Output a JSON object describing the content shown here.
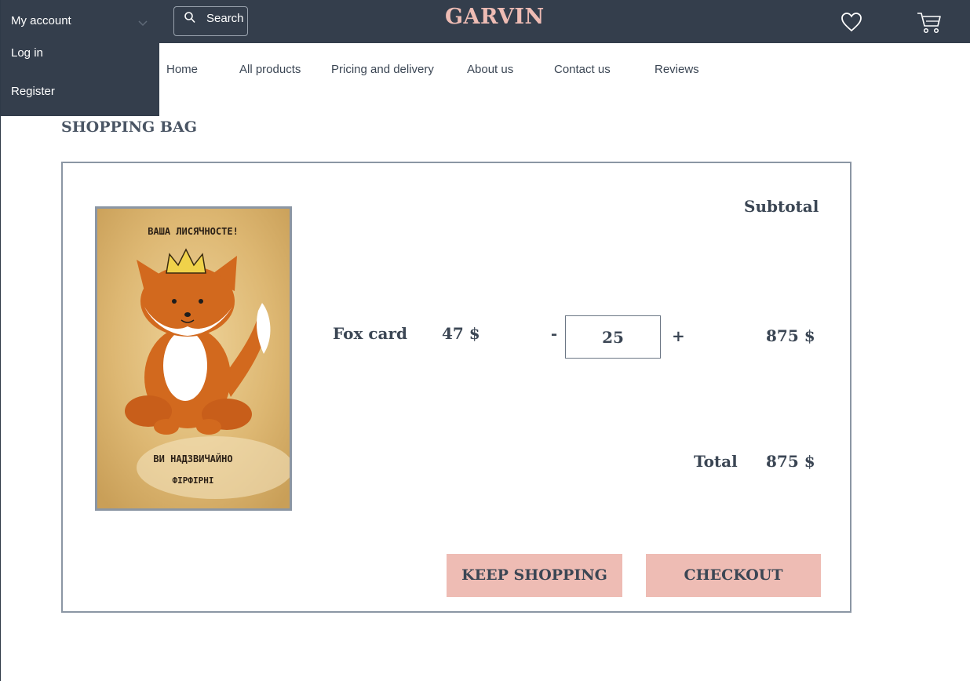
{
  "header": {
    "account_label": "My account",
    "account_menu": {
      "login_label": "Log in",
      "register_label": "Register"
    },
    "search_label": "Search",
    "logo_text": "GARVIN",
    "icons": {
      "search": "search-icon",
      "favorites": "heart-icon",
      "cart": "cart-icon",
      "dropdown": "chevron-down-icon"
    }
  },
  "nav": {
    "items": [
      "Home",
      "All products",
      "Pricing and delivery",
      "About us",
      "Contact us",
      "Reviews"
    ]
  },
  "page": {
    "title": "SHOPPING BAG"
  },
  "bag": {
    "subtotal_heading": "Subtotal",
    "item": {
      "name": "Fox card",
      "price": "47 $",
      "quantity": "25",
      "subtotal": "875 $",
      "image_text_top": "ВАША ЛИСЯЧНОСТЕ!",
      "image_text_bottom_1": "ВИ НАДЗВИЧАЙНО",
      "image_text_bottom_2": "ФІРФІРНІ"
    },
    "qty_minus": "-",
    "qty_plus": "+",
    "total_label": "Total",
    "total_value": "875 $",
    "keep_shopping_label": "KEEP SHOPPING",
    "checkout_label": "CHECKOUT"
  },
  "colors": {
    "header_bg": "#343e4c",
    "accent_pink": "#eebcb4",
    "text_dark": "#3b4654",
    "border_gray": "#8b96a4"
  }
}
